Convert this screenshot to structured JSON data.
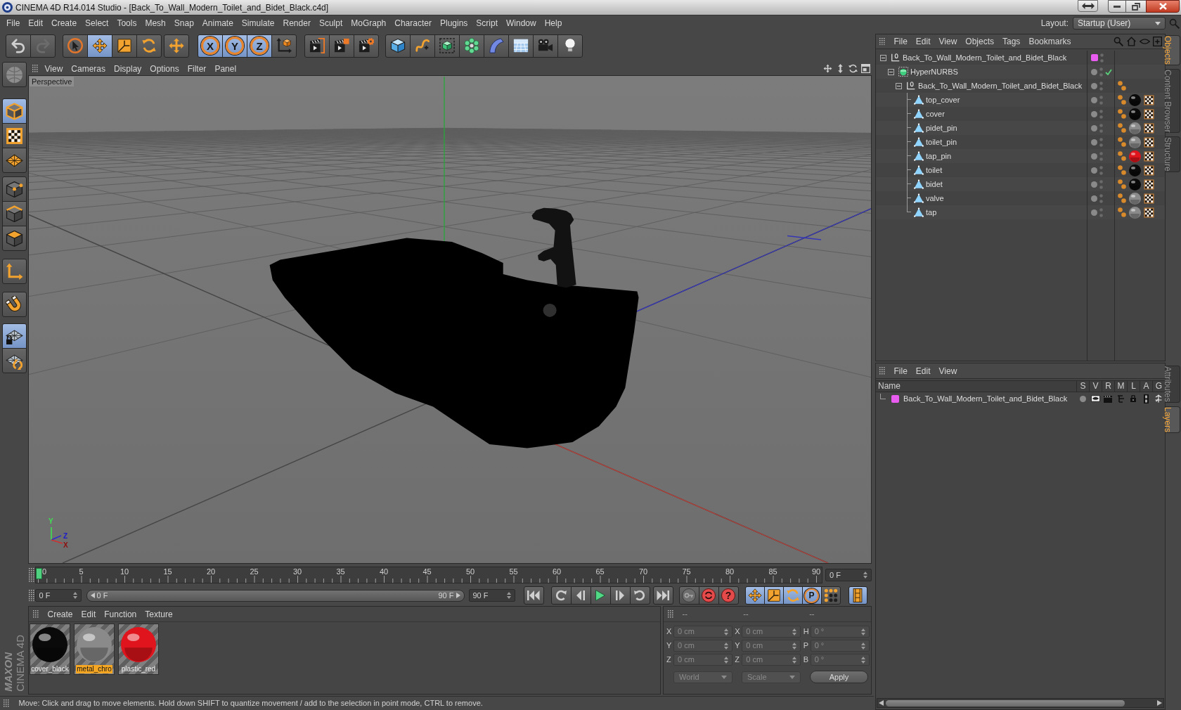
{
  "window": {
    "title": "CINEMA 4D R14.014 Studio - [Back_To_Wall_Modern_Toilet_and_Bidet_Black.c4d]"
  },
  "menu_bar": [
    "File",
    "Edit",
    "Create",
    "Select",
    "Tools",
    "Mesh",
    "Snap",
    "Animate",
    "Simulate",
    "Render",
    "Sculpt",
    "MoGraph",
    "Character",
    "Plugins",
    "Script",
    "Window",
    "Help"
  ],
  "layout": {
    "label": "Layout:",
    "value": "Startup (User)"
  },
  "toolbar": {
    "history": [
      {
        "disabled": false
      },
      {
        "disabled": true
      }
    ],
    "modes": [
      {
        "selected": false
      },
      {
        "selected": true
      },
      {
        "selected": false
      },
      {
        "selected": false
      },
      {
        "selected": false
      }
    ],
    "axis_locks": [
      {
        "label": "X",
        "selected": true
      },
      {
        "label": "Y",
        "selected": true
      },
      {
        "label": "Z",
        "selected": true
      }
    ]
  },
  "mode_palette": [
    {
      "selected": false
    },
    {
      "selected": true
    },
    {
      "selected": false
    },
    {
      "selected": false
    },
    {
      "selected": false
    },
    {
      "selected": false
    },
    {
      "selected": false
    },
    {
      "selected": false
    },
    {
      "selected": false
    },
    {
      "selected": true
    },
    {
      "selected": false
    }
  ],
  "brand": {
    "line_1": "MAXON",
    "line_2": "CINEMA 4D"
  },
  "viewport": {
    "menu": [
      "View",
      "Cameras",
      "Display",
      "Options",
      "Filter",
      "Panel"
    ],
    "camera": "Perspective",
    "gizmo_labels": [
      "Y",
      "Z",
      "X"
    ]
  },
  "timeline": {
    "frame_labels": [
      "0",
      "5",
      "10",
      "15",
      "20",
      "25",
      "30",
      "35",
      "40",
      "45",
      "50",
      "55",
      "60",
      "65",
      "70",
      "75",
      "80",
      "85",
      "90"
    ],
    "playhead": {
      "level": 0
    },
    "current_frame": "0 F"
  },
  "transport": {
    "start_frame": "0 F",
    "range_start": "0 F",
    "range_end": "90 F",
    "end_frame": "90 F",
    "help_label": "?",
    "key_modes": [
      {
        "selected": true
      },
      {
        "selected": true
      },
      {
        "selected": true
      },
      {
        "label": "P",
        "selected": true
      },
      {
        "selected": false
      }
    ],
    "timeline_toggle": {
      "selected": true
    }
  },
  "material_manager": {
    "menu": [
      "Create",
      "Edit",
      "Function",
      "Texture"
    ],
    "materials": [
      {
        "name": "cover_black",
        "color": "#0a0a0a",
        "selected": false
      },
      {
        "name": "metal_chro",
        "color": "#8a8a8a",
        "selected": true
      },
      {
        "name": "plastic_red",
        "color": "#e0141c",
        "selected": false
      }
    ]
  },
  "coordinates": {
    "headers": [
      "--",
      "--",
      "--"
    ],
    "columns": [
      [
        {
          "label": "X",
          "value": "0 cm"
        },
        {
          "label": "Y",
          "value": "0 cm"
        },
        {
          "label": "Z",
          "value": "0 cm"
        }
      ],
      [
        {
          "label": "X",
          "value": "0 cm"
        },
        {
          "label": "Y",
          "value": "0 cm"
        },
        {
          "label": "Z",
          "value": "0 cm"
        }
      ],
      [
        {
          "label": "H",
          "value": "0 °"
        },
        {
          "label": "P",
          "value": "0 °"
        },
        {
          "label": "B",
          "value": "0 °"
        }
      ]
    ],
    "dropdowns": [
      "World",
      "Scale"
    ],
    "apply": "Apply"
  },
  "status_bar": "Move: Click and drag to move elements. Hold down SHIFT to quantize movement / add to the selection in point mode, CTRL to remove.",
  "object_manager": {
    "menu": [
      "File",
      "Edit",
      "View",
      "Objects",
      "Tags",
      "Bookmarks"
    ],
    "tree": [
      {
        "name": "Back_To_Wall_Modern_Toilet_and_Bidet_Black",
        "kind": "null",
        "color": "#e95cf0",
        "expanded": true,
        "children": [
          {
            "name": "HyperNURBS",
            "kind": "nurbs",
            "enabled": true,
            "expanded": true,
            "children": [
              {
                "name": "Back_To_Wall_Modern_Toilet_and_Bidet_Black",
                "kind": "null",
                "expanded": true,
                "tags": [
                  {
                    "kind": "phong"
                  }
                ],
                "children": [
                  {
                    "name": "top_cover",
                    "kind": "mesh",
                    "tags": [
                      {
                        "kind": "phong"
                      },
                      {
                        "kind": "material",
                        "color": "#0a0a0a"
                      },
                      {
                        "kind": "uvw"
                      }
                    ]
                  },
                  {
                    "name": "cover",
                    "kind": "mesh",
                    "tags": [
                      {
                        "kind": "phong"
                      },
                      {
                        "kind": "material",
                        "color": "#0a0a0a"
                      },
                      {
                        "kind": "uvw"
                      }
                    ]
                  },
                  {
                    "name": "pidet_pin",
                    "kind": "mesh",
                    "tags": [
                      {
                        "kind": "phong"
                      },
                      {
                        "kind": "material",
                        "color": "#8a8a8a"
                      },
                      {
                        "kind": "uvw"
                      }
                    ]
                  },
                  {
                    "name": "toilet_pin",
                    "kind": "mesh",
                    "tags": [
                      {
                        "kind": "phong"
                      },
                      {
                        "kind": "material",
                        "color": "#8a8a8a"
                      },
                      {
                        "kind": "uvw"
                      }
                    ]
                  },
                  {
                    "name": "tap_pin",
                    "kind": "mesh",
                    "tags": [
                      {
                        "kind": "phong"
                      },
                      {
                        "kind": "material",
                        "color": "#e0141c"
                      },
                      {
                        "kind": "uvw"
                      }
                    ]
                  },
                  {
                    "name": "toilet",
                    "kind": "mesh",
                    "tags": [
                      {
                        "kind": "phong"
                      },
                      {
                        "kind": "material",
                        "color": "#0a0a0a"
                      },
                      {
                        "kind": "uvw"
                      }
                    ]
                  },
                  {
                    "name": "bidet",
                    "kind": "mesh",
                    "tags": [
                      {
                        "kind": "phong"
                      },
                      {
                        "kind": "material",
                        "color": "#0a0a0a"
                      },
                      {
                        "kind": "uvw"
                      }
                    ]
                  },
                  {
                    "name": "valve",
                    "kind": "mesh",
                    "tags": [
                      {
                        "kind": "phong"
                      },
                      {
                        "kind": "material",
                        "color": "#8a8a8a"
                      },
                      {
                        "kind": "uvw"
                      }
                    ]
                  },
                  {
                    "name": "tap",
                    "kind": "mesh",
                    "tags": [
                      {
                        "kind": "phong"
                      },
                      {
                        "kind": "material",
                        "color": "#8a8a8a"
                      },
                      {
                        "kind": "uvw"
                      }
                    ]
                  }
                ]
              }
            ]
          }
        ]
      }
    ]
  },
  "object_tabs": [
    {
      "label": "Objects",
      "selected": true
    },
    {
      "label": "Content Browser",
      "selected": false
    },
    {
      "label": "Structure",
      "selected": false
    }
  ],
  "layer_manager": {
    "menu": [
      "File",
      "Edit",
      "View"
    ],
    "columns": [
      "Name",
      "S",
      "V",
      "R",
      "M",
      "L",
      "A",
      "G"
    ],
    "layers": [
      {
        "name": "Back_To_Wall_Modern_Toilet_and_Bidet_Black",
        "color": "#e95cf0"
      }
    ]
  },
  "layer_tabs": [
    {
      "label": "Attributes",
      "selected": false
    },
    {
      "label": "Layers",
      "selected": true
    }
  ]
}
